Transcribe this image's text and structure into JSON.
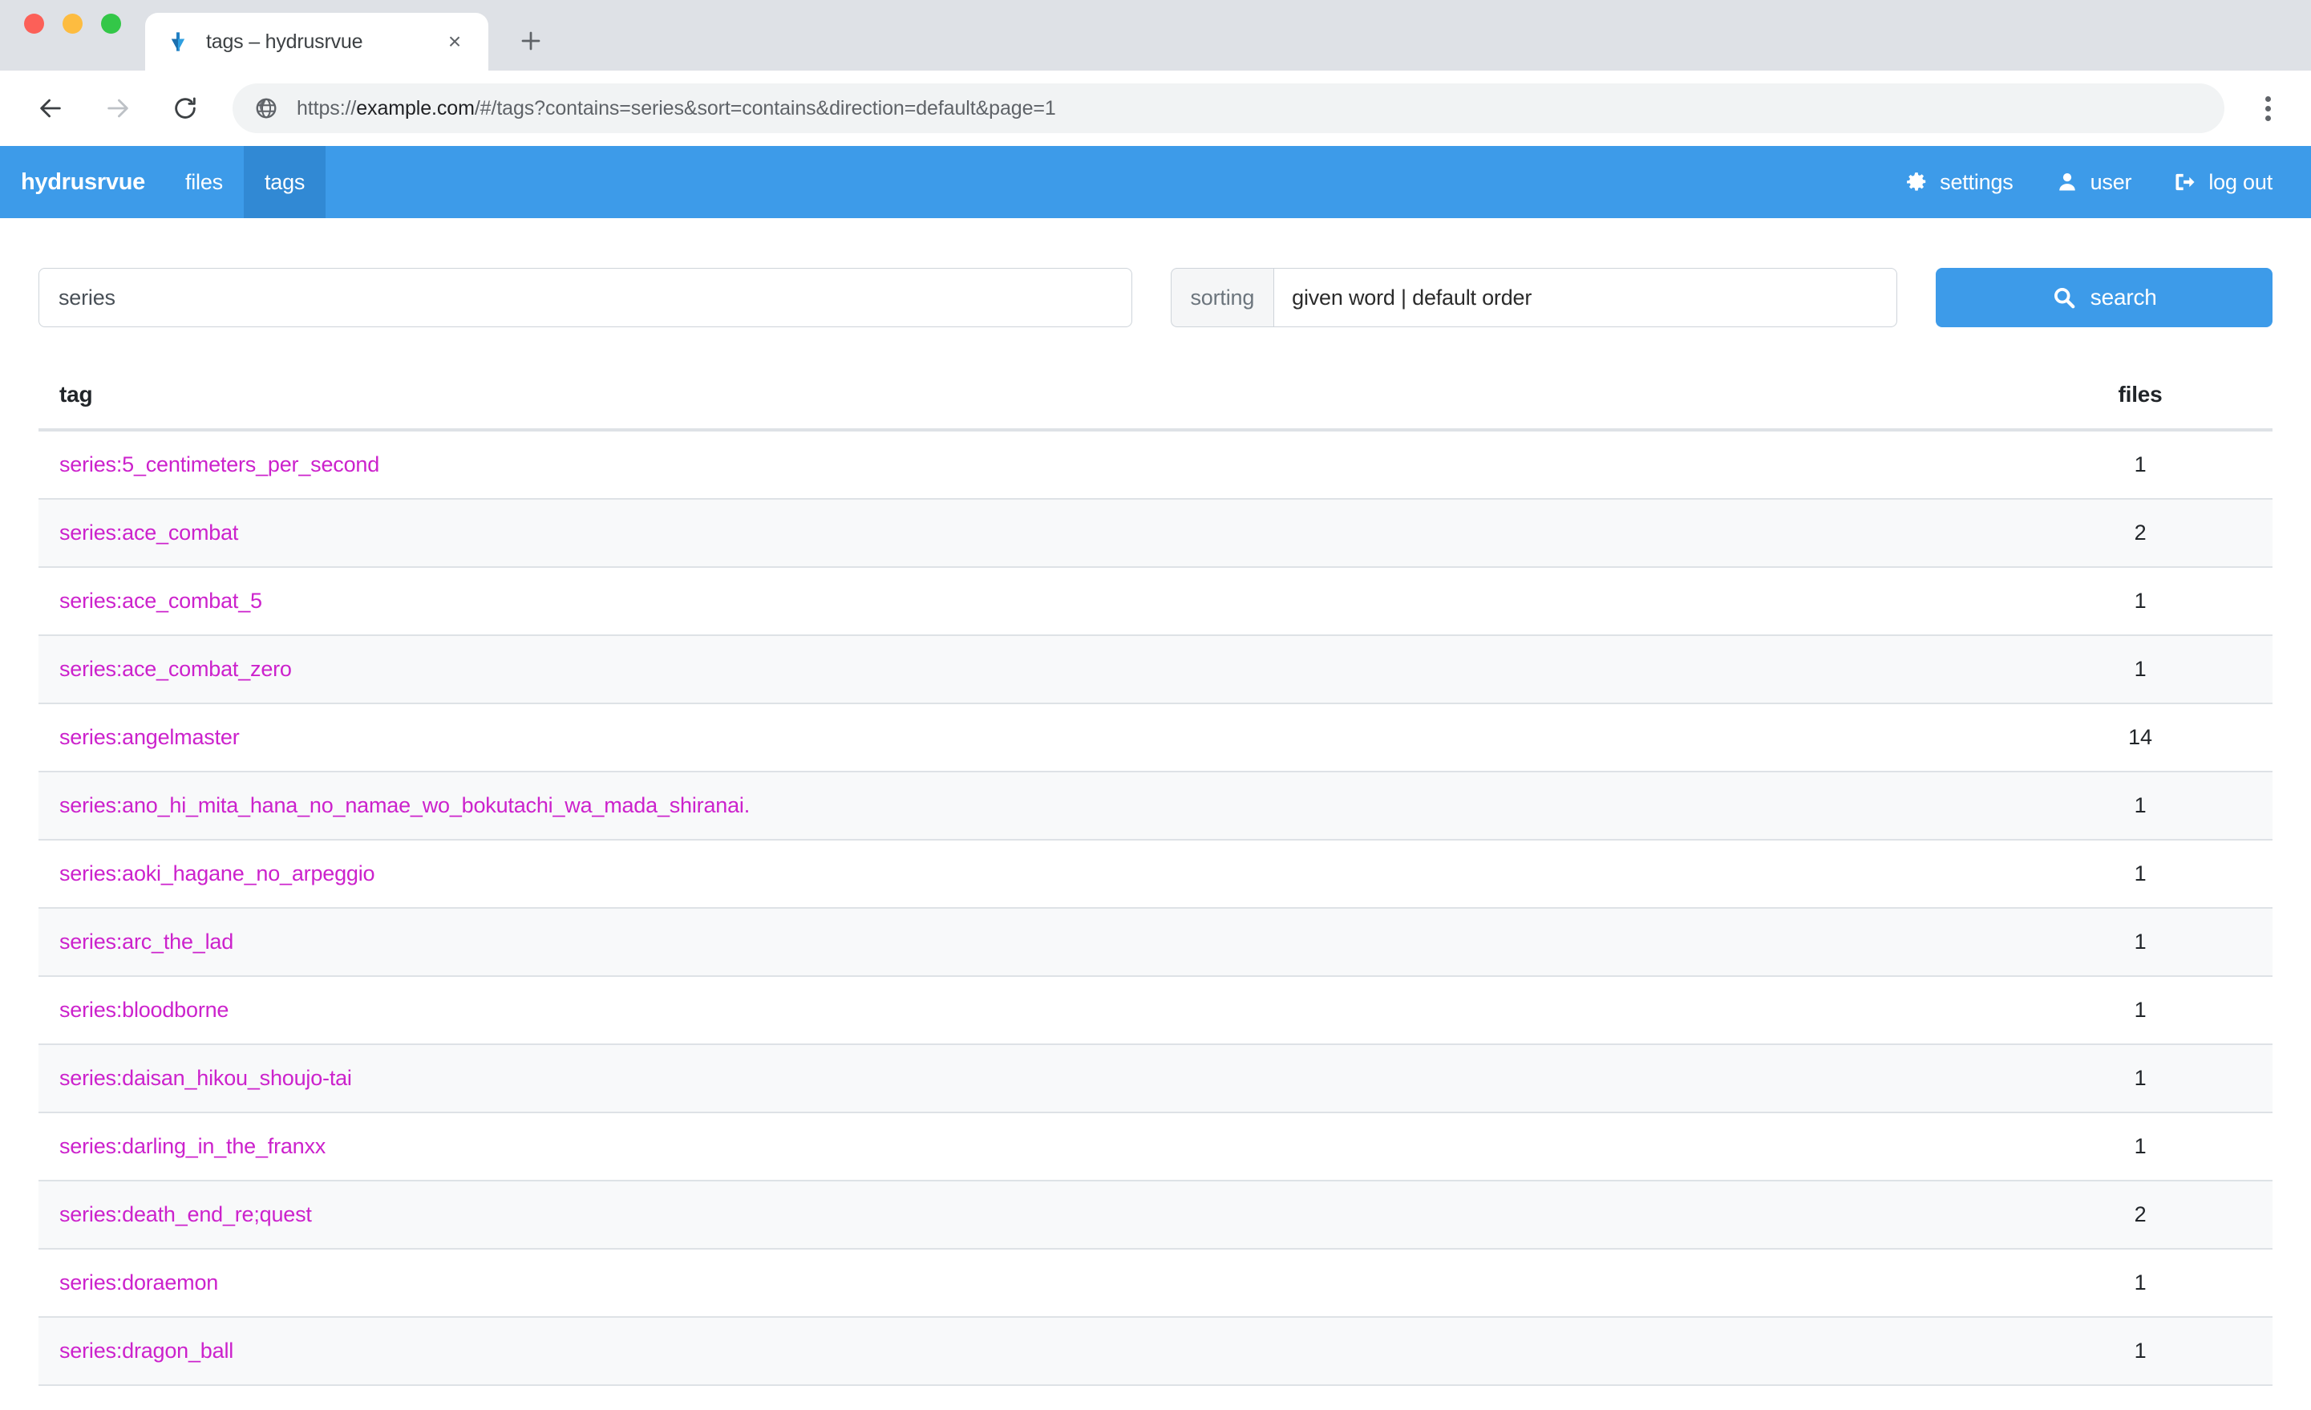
{
  "browser": {
    "tab": {
      "title": "tags – hydrusrvue",
      "favicon": "hydrus-arrow-icon",
      "close_label": "×"
    },
    "new_tab_label": "+",
    "back_icon": "arrow-left-icon",
    "forward_icon": "arrow-right-icon",
    "reload_icon": "reload-icon",
    "site_icon": "globe-icon",
    "url_full": "https://example.com/#/tags?contains=series&sort=contains&direction=default&page=1",
    "url_prefix": "https://",
    "url_host": "example.com",
    "url_path": "/#/tags?contains=series&sort=contains&direction=default&page=1",
    "menu_icon": "kebab-menu-icon"
  },
  "navbar": {
    "brand": "hydrusrvue",
    "left_items": [
      {
        "label": "files",
        "active": false
      },
      {
        "label": "tags",
        "active": true
      }
    ],
    "right_items": [
      {
        "label": "settings",
        "icon": "gear-icon"
      },
      {
        "label": "user",
        "icon": "user-icon"
      },
      {
        "label": "log out",
        "icon": "sign-out-icon"
      }
    ]
  },
  "search": {
    "tag_input_value": "series",
    "tag_input_placeholder": "",
    "sorting_label": "sorting",
    "sorting_value": "given word | default order",
    "search_button_label": "search",
    "search_icon": "search-icon"
  },
  "table": {
    "columns": [
      "tag",
      "files"
    ],
    "rows": [
      {
        "tag": "series:5_centimeters_per_second",
        "files": "1"
      },
      {
        "tag": "series:ace_combat",
        "files": "2"
      },
      {
        "tag": "series:ace_combat_5",
        "files": "1"
      },
      {
        "tag": "series:ace_combat_zero",
        "files": "1"
      },
      {
        "tag": "series:angelmaster",
        "files": "14"
      },
      {
        "tag": "series:ano_hi_mita_hana_no_namae_wo_bokutachi_wa_mada_shiranai.",
        "files": "1"
      },
      {
        "tag": "series:aoki_hagane_no_arpeggio",
        "files": "1"
      },
      {
        "tag": "series:arc_the_lad",
        "files": "1"
      },
      {
        "tag": "series:bloodborne",
        "files": "1"
      },
      {
        "tag": "series:daisan_hikou_shoujo-tai",
        "files": "1"
      },
      {
        "tag": "series:darling_in_the_franxx",
        "files": "1"
      },
      {
        "tag": "series:death_end_re;quest",
        "files": "2"
      },
      {
        "tag": "series:doraemon",
        "files": "1"
      },
      {
        "tag": "series:dragon_ball",
        "files": "1"
      }
    ]
  },
  "colors": {
    "navbar_blue": "#3d9be9",
    "navbar_active": "#3189d4",
    "tag_link": "#cc22cc",
    "row_alt": "#f8f9fa",
    "border": "#dee2e6"
  }
}
